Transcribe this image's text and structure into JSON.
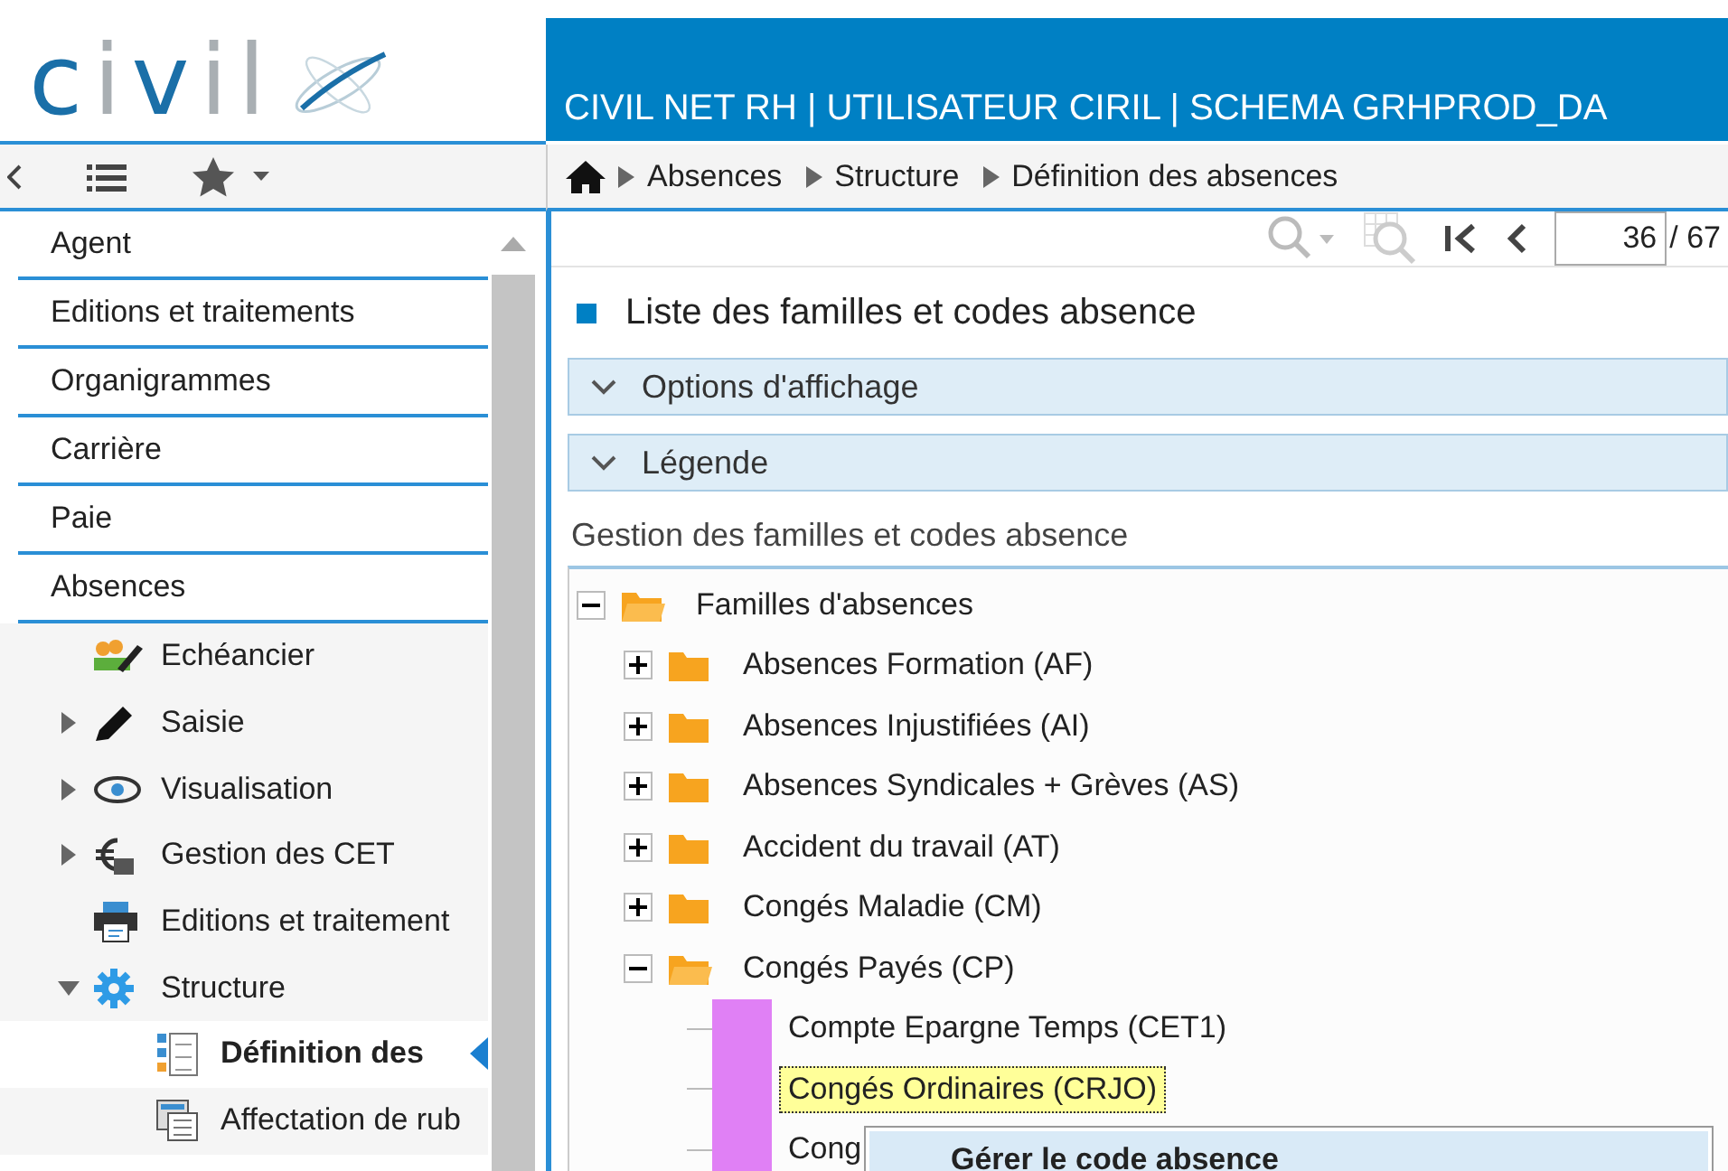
{
  "logo": {
    "segments": [
      {
        "text": "c",
        "accent": true
      },
      {
        "text": "i",
        "accent": false
      },
      {
        "text": "v",
        "accent": true
      },
      {
        "text": "il",
        "accent": false
      }
    ]
  },
  "header": {
    "title": "CIVIL NET RH | UTILISATEUR CIRIL | SCHEMA GRHPROD_DA"
  },
  "breadcrumb": [
    "Absences",
    "Structure",
    "Définition des absences"
  ],
  "nav": [
    {
      "label": "Agent"
    },
    {
      "label": "Editions et traitements"
    },
    {
      "label": "Organigrammes"
    },
    {
      "label": "Carrière"
    },
    {
      "label": "Paie"
    },
    {
      "label": "Absences",
      "children": [
        {
          "label": "Echéancier"
        },
        {
          "label": "Saisie",
          "expanded": false
        },
        {
          "label": "Visualisation",
          "expanded": false
        },
        {
          "label": "Gestion des CET",
          "expanded": false
        },
        {
          "label": "Editions et traitement"
        },
        {
          "label": "Structure",
          "expanded": true,
          "children": [
            {
              "label": "Définition des",
              "selected": true
            },
            {
              "label": "Affectation de rub",
              "selected": false
            }
          ]
        }
      ]
    }
  ],
  "pager": {
    "page": "36",
    "total": "/ 67"
  },
  "list_title": "Liste des familles et codes absence",
  "panels": [
    {
      "label": "Options d'affichage",
      "expanded": false
    },
    {
      "label": "Légende",
      "expanded": false
    }
  ],
  "tree_title": "Gestion des familles et codes absence",
  "tree": {
    "label": "Familles d'absences",
    "expanded": true,
    "children": [
      {
        "kind": "family",
        "label": "Absences Formation (AF)",
        "expanded": false
      },
      {
        "kind": "family",
        "label": "Absences Injustifiées (AI)",
        "expanded": false
      },
      {
        "kind": "family",
        "label": "Absences Syndicales + Grèves (AS)",
        "expanded": false
      },
      {
        "kind": "family",
        "label": "Accident du travail (AT)",
        "expanded": false
      },
      {
        "kind": "family",
        "label": "Congés Maladie (CM)",
        "expanded": false
      },
      {
        "kind": "family",
        "label": "Congés Payés (CP)",
        "expanded": true,
        "children": [
          {
            "kind": "code",
            "label": "Compte Epargne Temps (CET1)",
            "color": "#e080f5",
            "selected": false
          },
          {
            "kind": "code",
            "label": "Congés Ordinaires (CRJO)",
            "color": "#e080f5",
            "selected": true
          },
          {
            "kind": "code",
            "label": "Cong",
            "color": "#e080f5",
            "selected": false
          }
        ]
      }
    ]
  },
  "context_menu": [
    {
      "label": "Gérer le code absence",
      "selected": true
    }
  ]
}
